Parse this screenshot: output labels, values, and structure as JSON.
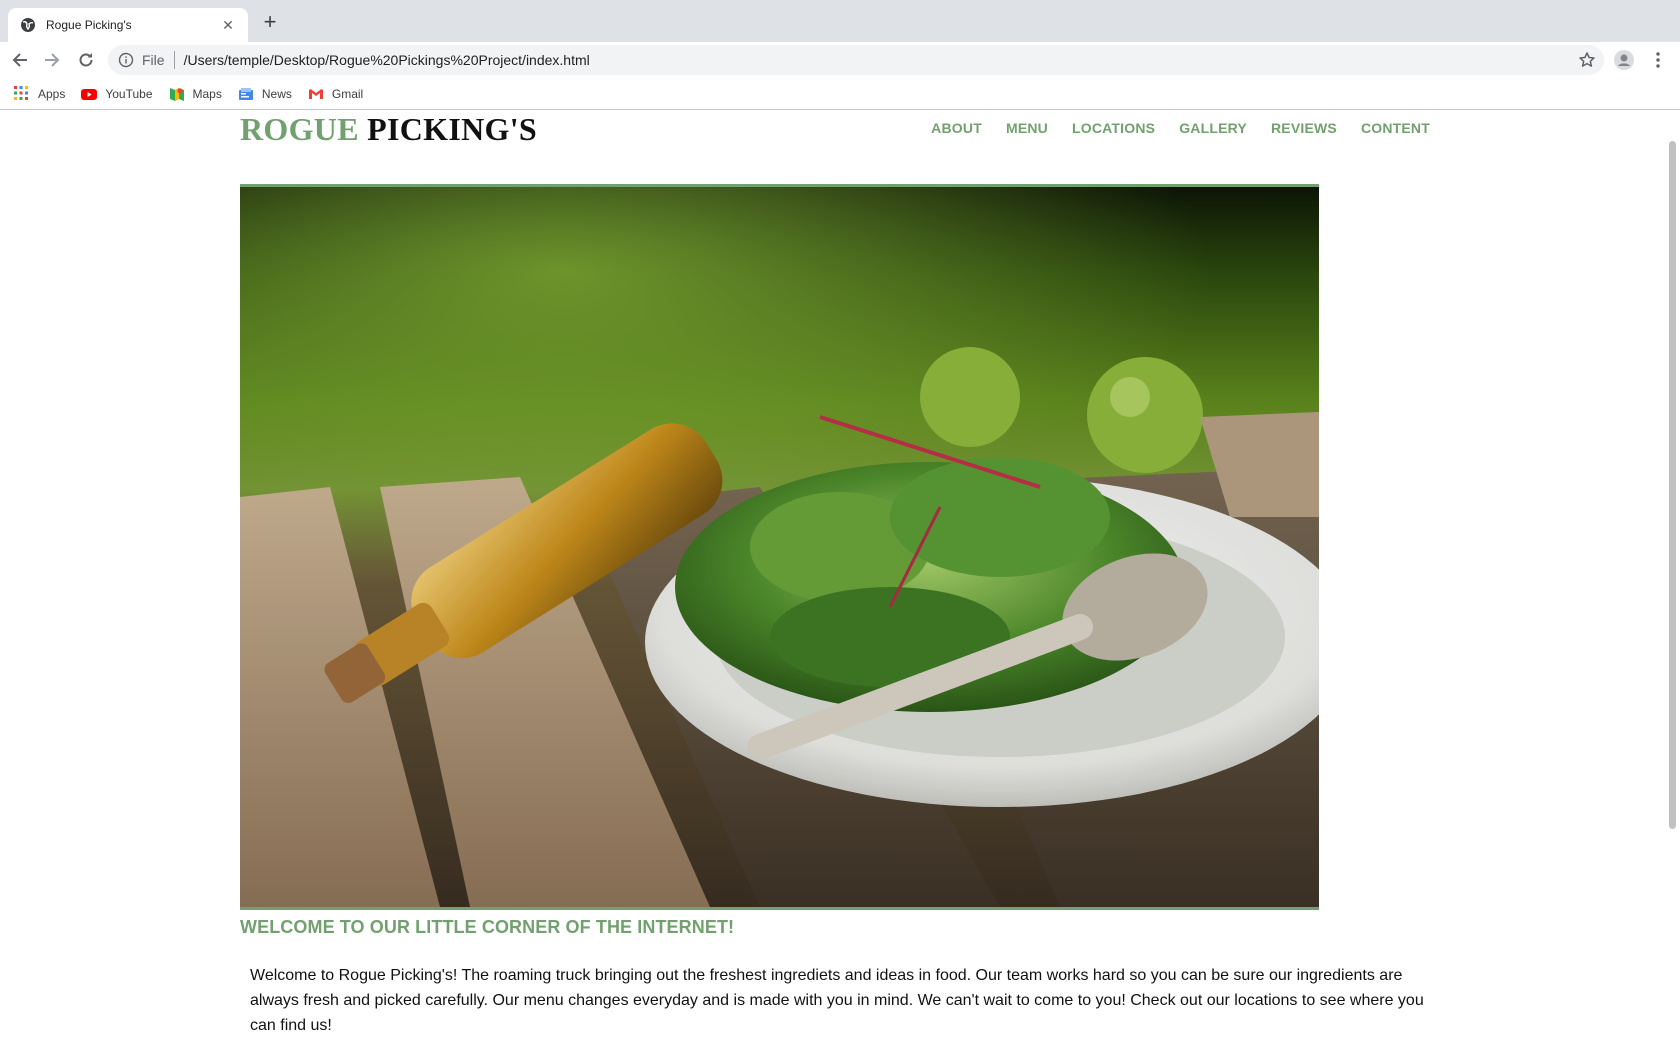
{
  "browser": {
    "tab_title": "Rogue Picking's",
    "tab_close": "✕",
    "new_tab": "+",
    "scheme_label": "File",
    "url": "/Users/temple/Desktop/Rogue%20Pickings%20Project/index.html",
    "bookmarks": [
      {
        "label": "Apps",
        "icon": "apps-grid-icon"
      },
      {
        "label": "YouTube",
        "icon": "youtube-icon"
      },
      {
        "label": "Maps",
        "icon": "maps-icon"
      },
      {
        "label": "News",
        "icon": "news-icon"
      },
      {
        "label": "Gmail",
        "icon": "gmail-icon"
      }
    ]
  },
  "site": {
    "logo_part1": "ROGUE",
    "logo_part2": "PICKING'S",
    "nav": [
      "ABOUT",
      "MENU",
      "LOCATIONS",
      "GALLERY",
      "REVIEWS",
      "CONTENT"
    ],
    "hero_image": "salad-bowl-with-olive-oil-bottle-on-wooden-table-photo",
    "welcome_heading": "WELCOME TO OUR LITTLE CORNER OF THE INTERNET!",
    "welcome_text": "Welcome to Rogue Picking's! The roaming truck bringing out the freshest ingrediets and ideas in food. Our team works hard so you can be sure our ingredients are always fresh and picked carefully. Our menu changes everyday and is made with you in mind. We can't wait to come to you! Check out our locations to see where you can find us!"
  },
  "colors": {
    "accent": "#73a06f",
    "text": "#111111",
    "tabstrip": "#dee1e6",
    "omnibox": "#f1f3f4"
  }
}
